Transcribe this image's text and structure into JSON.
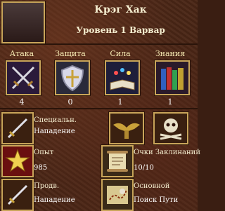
{
  "hero": {
    "name": "Крэг Хак",
    "class": "Уровень 1 Варвар"
  },
  "stats": [
    {
      "label": "Атака",
      "value": "4",
      "icon": "crossed-swords-icon"
    },
    {
      "label": "Защита",
      "value": "0",
      "icon": "shield-icon"
    },
    {
      "label": "Сила",
      "value": "1",
      "icon": "spellbook-icon"
    },
    {
      "label": "Знания",
      "value": "1",
      "icon": "books-icon"
    }
  ],
  "specialty": {
    "label": "Специальн.",
    "value": "Нападение",
    "icon": "sword-icon"
  },
  "experience": {
    "label": "Опыт",
    "value": "985",
    "icon": "star-icon"
  },
  "spell_points": {
    "label": "Очки Заклинаний",
    "value": "10/10",
    "icon": "scroll-icon"
  },
  "secondary_skills": [
    {
      "label": "Продв.",
      "value": "Нападение",
      "icon": "sword-icon"
    },
    {
      "label": "Основной",
      "value": "Поиск Пути",
      "icon": "map-icon"
    }
  ],
  "luck_morale_icons": [
    "eagle-icon",
    "skull-icon"
  ]
}
